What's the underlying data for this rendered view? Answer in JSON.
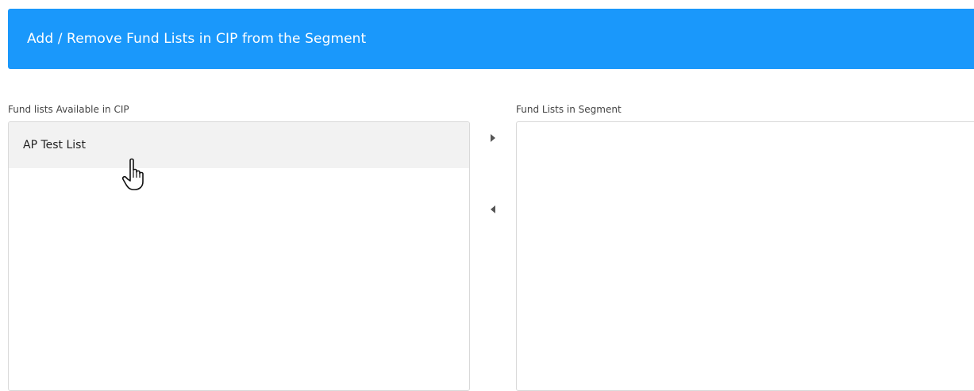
{
  "header": {
    "title": "Add / Remove Fund Lists in CIP from the Segment",
    "background_color": "#1a98fb"
  },
  "available_panel": {
    "label": "Fund lists Available in CIP",
    "items": [
      {
        "label": "AP Test List",
        "hovered": true
      }
    ]
  },
  "segment_panel": {
    "label": "Fund Lists in Segment",
    "items": []
  },
  "controls": {
    "move_right_icon": "triangle-right-icon",
    "move_left_icon": "triangle-left-icon"
  },
  "pointer": {
    "icon": "hand-pointer-icon"
  }
}
